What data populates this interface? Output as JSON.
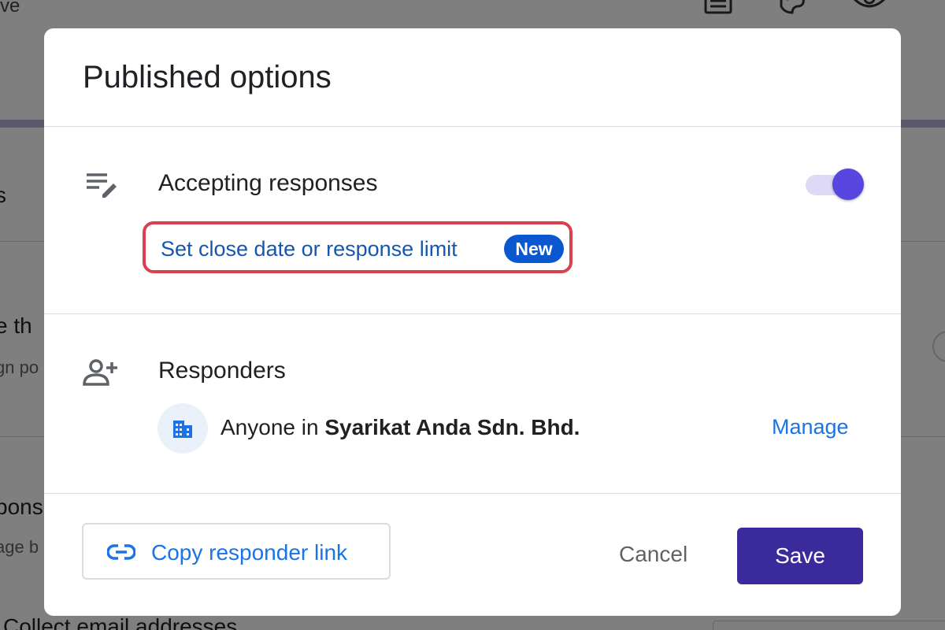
{
  "background": {
    "top_text": "ve",
    "row1_text": "s",
    "row2_text": "e th",
    "row2_sub": "gn po",
    "row3_text": "pons",
    "row3_sub": "age b",
    "row4_text": "Collect email addresses"
  },
  "dialog": {
    "title": "Published options",
    "accepting": {
      "label": "Accepting responses",
      "toggle_on": true,
      "limit_link": "Set close date or response limit",
      "badge": "New"
    },
    "responders": {
      "label": "Responders",
      "prefix": "Anyone in ",
      "org": "Syarikat Anda Sdn. Bhd.",
      "manage": "Manage"
    },
    "footer": {
      "copy_link": "Copy responder link",
      "cancel": "Cancel",
      "save": "Save"
    }
  },
  "colors": {
    "accent": "#5846e1",
    "save_button": "#3b2a9c",
    "link": "#1a73e8",
    "highlight_border": "#d9414f",
    "badge": "#0b57d0"
  },
  "icons": {
    "accepting": "edit-list-icon",
    "responders": "add-person-icon",
    "org": "building-icon",
    "copy": "link-icon"
  }
}
